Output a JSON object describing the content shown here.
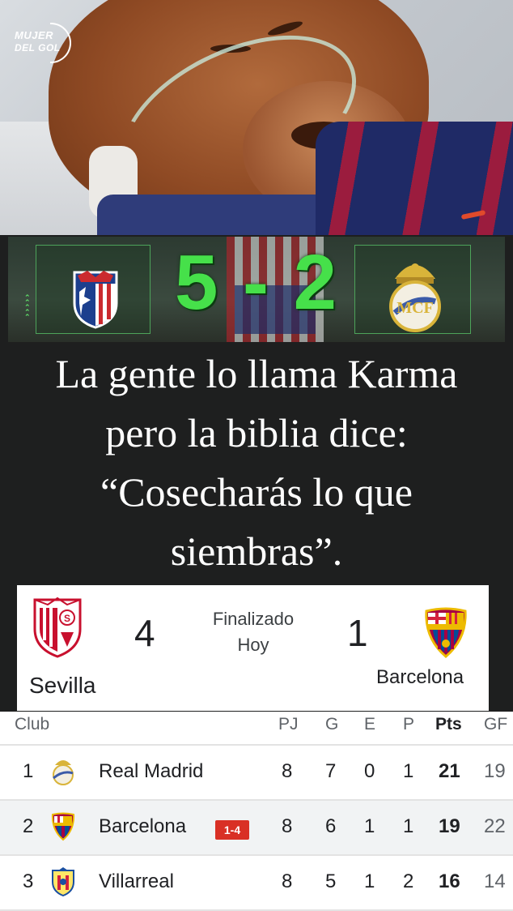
{
  "watermark": {
    "line1": "MUJER",
    "line2": "DEL GOL"
  },
  "derby": {
    "score": "5 - 2",
    "home_crest": "atletico-madrid-crest",
    "away_crest": "real-madrid-crest",
    "score_color": "#46e04a"
  },
  "caption": {
    "line1": "La gente lo llama Karma",
    "line2": "pero la biblia dice:",
    "line3": "“Cosecharás lo que",
    "line4": "siembras”."
  },
  "match": {
    "home_team": "Sevilla",
    "home_score": "4",
    "status": "Finalizado",
    "date": "Hoy",
    "away_score": "1",
    "away_team": "Barcelona"
  },
  "standings": {
    "headers": {
      "club": "Club",
      "pj": "PJ",
      "g": "G",
      "e": "E",
      "p": "P",
      "pts": "Pts",
      "gf": "GF"
    },
    "rows": [
      {
        "pos": "1",
        "club": "Real Madrid",
        "pj": "8",
        "g": "7",
        "e": "0",
        "p": "1",
        "pts": "21",
        "gf": "19",
        "crest": "real-madrid-crest"
      },
      {
        "pos": "2",
        "club": "Barcelona",
        "badge": "1-4",
        "pj": "8",
        "g": "6",
        "e": "1",
        "p": "1",
        "pts": "19",
        "gf": "22",
        "crest": "barcelona-crest"
      },
      {
        "pos": "3",
        "club": "Villarreal",
        "pj": "8",
        "g": "5",
        "e": "1",
        "p": "2",
        "pts": "16",
        "gf": "14",
        "crest": "villarreal-crest"
      }
    ],
    "badge_color": "#d93025"
  }
}
